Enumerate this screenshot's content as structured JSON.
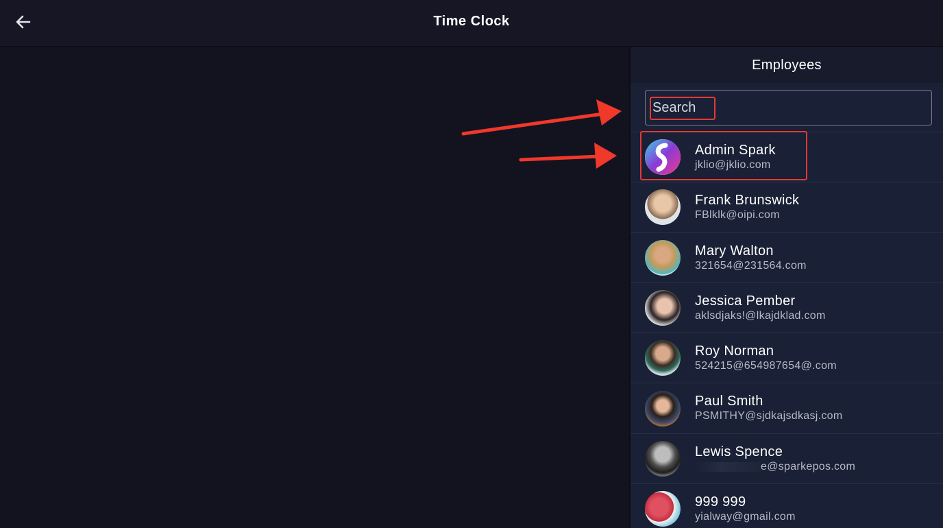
{
  "header": {
    "title": "Time Clock",
    "back_icon": "arrow-left-icon"
  },
  "panel": {
    "title": "Employees",
    "search_placeholder": "Search"
  },
  "employees": [
    {
      "name": "Admin Spark",
      "email": "jklio@jklio.com",
      "avatar": "spark-logo-icon"
    },
    {
      "name": "Frank Brunswick",
      "email": "FBlklk@oipi.com",
      "avatar": "user-photo"
    },
    {
      "name": "Mary Walton",
      "email": "321654@231564.com",
      "avatar": "user-photo"
    },
    {
      "name": "Jessica Pember",
      "email": "aklsdjaks!@lkajdklad.com",
      "avatar": "user-photo"
    },
    {
      "name": "Roy Norman",
      "email": "524215@654987654@.com",
      "avatar": "user-photo"
    },
    {
      "name": "Paul Smith",
      "email": "PSMITHY@sjdkajsdkasj.com",
      "avatar": "user-photo"
    },
    {
      "name": "Lewis Spence",
      "email": "e@sparkepos.com",
      "avatar": "user-photo"
    },
    {
      "name": "999 999",
      "email": "yialway@gmail.com",
      "avatar": "user-photo"
    }
  ],
  "colors": {
    "background": "#13131f",
    "panel": "#1a2035",
    "annotation": "#e53935"
  }
}
